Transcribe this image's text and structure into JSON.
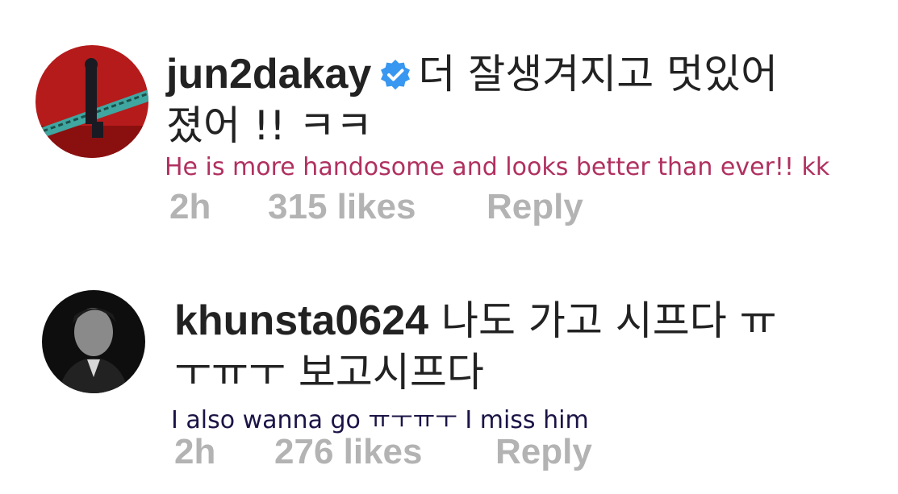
{
  "comments": [
    {
      "username": "jun2dakay",
      "verified": true,
      "text_line1": "더 잘생겨지고 멋있어",
      "text_line2": "졌어 !! ㅋㅋ",
      "translation": "He is more handosome and looks better than ever!! kk",
      "translation_color": "#b03060",
      "time": "2h",
      "likes": "315 likes",
      "reply": "Reply"
    },
    {
      "username": "khunsta0624",
      "verified": false,
      "text_line1": "나도 가고 시프다 ㅠ",
      "text_line2": "ㅜㅠㅜ 보고시프다",
      "translation": "I also wanna go ㅠㅜㅠㅜ I miss him",
      "translation_color": "#1a1446",
      "time": "2h",
      "likes": "276 likes",
      "reply": "Reply"
    }
  ],
  "colors": {
    "text": "#222222",
    "meta": "#b3b3b3",
    "verified_badge": "#3897f0"
  }
}
